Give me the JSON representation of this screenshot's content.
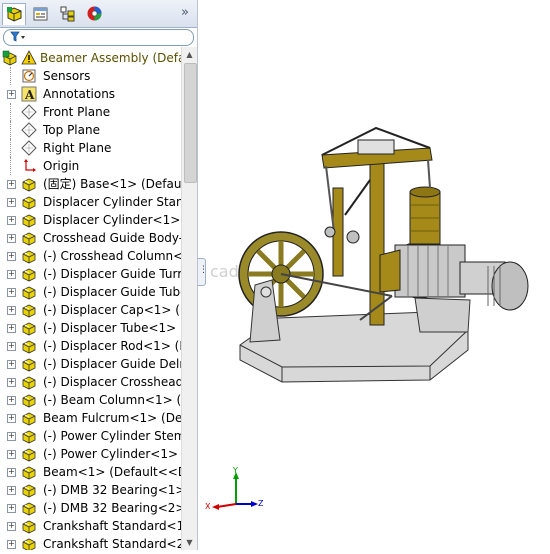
{
  "tabs": [
    {
      "name": "feature-manager",
      "active": true
    },
    {
      "name": "property-manager",
      "active": false
    },
    {
      "name": "configuration-manager",
      "active": false
    },
    {
      "name": "display-manager",
      "active": false
    }
  ],
  "more_symbol": "»",
  "tree": {
    "root_label": "Beamer Assembly  (Defa",
    "items": [
      {
        "label": "Sensors",
        "icon": "sensors-icon",
        "expand": false
      },
      {
        "label": "Annotations",
        "icon": "annotations-icon",
        "expand": true
      },
      {
        "label": "Front Plane",
        "icon": "plane-icon",
        "expand": false
      },
      {
        "label": "Top Plane",
        "icon": "plane-icon",
        "expand": false
      },
      {
        "label": "Right Plane",
        "icon": "plane-icon",
        "expand": false
      },
      {
        "label": "Origin",
        "icon": "origin-icon",
        "expand": false
      },
      {
        "label": "(固定) Base<1> (Default",
        "icon": "part-icon",
        "expand": true
      },
      {
        "label": "Displacer Cylinder Stanc",
        "icon": "part-icon",
        "expand": true
      },
      {
        "label": "Displacer Cylinder<1> (",
        "icon": "part-icon",
        "expand": true
      },
      {
        "label": "Crosshead Guide Body-",
        "icon": "part-icon",
        "expand": true
      },
      {
        "label": "(-) Crosshead Column<",
        "icon": "part-icon",
        "expand": true
      },
      {
        "label": "(-) Displacer Guide Turr",
        "icon": "part-icon",
        "expand": true
      },
      {
        "label": "(-) Displacer Guide Tube",
        "icon": "part-icon",
        "expand": true
      },
      {
        "label": "(-) Displacer Cap<1> (D",
        "icon": "part-icon",
        "expand": true
      },
      {
        "label": "(-) Displacer Tube<1> (",
        "icon": "part-icon",
        "expand": true
      },
      {
        "label": "(-) Displacer Rod<1> (D",
        "icon": "part-icon",
        "expand": true
      },
      {
        "label": "(-) Displacer Guide Delr",
        "icon": "part-icon",
        "expand": true
      },
      {
        "label": "(-) Displacer Crosshead",
        "icon": "part-icon",
        "expand": true
      },
      {
        "label": "(-) Beam Column<1> (D",
        "icon": "part-icon",
        "expand": true
      },
      {
        "label": "Beam Fulcrum<1> (Defa",
        "icon": "part-icon",
        "expand": true
      },
      {
        "label": "(-) Power Cylinder Stem",
        "icon": "part-icon",
        "expand": true
      },
      {
        "label": "(-) Power Cylinder<1> (",
        "icon": "part-icon",
        "expand": true
      },
      {
        "label": "Beam<1> (Default<<De",
        "icon": "part-icon",
        "expand": true
      },
      {
        "label": "(-) DMB 32 Bearing<1>",
        "icon": "part-icon",
        "expand": true
      },
      {
        "label": "(-) DMB 32 Bearing<2>",
        "icon": "part-icon",
        "expand": true
      },
      {
        "label": "Crankshaft Standard<1",
        "icon": "part-icon",
        "expand": true
      },
      {
        "label": "Crankshaft Standard<2",
        "icon": "part-icon",
        "expand": true
      }
    ]
  },
  "watermark": "cad",
  "triad": {
    "x": "X",
    "y": "Y",
    "z": "Z"
  },
  "colors": {
    "part": "#d9c200",
    "brass": "#a58a1a",
    "steel": "#c8c8c8",
    "x_axis": "#d00000",
    "y_axis": "#00a000",
    "z_axis": "#0000c8"
  }
}
